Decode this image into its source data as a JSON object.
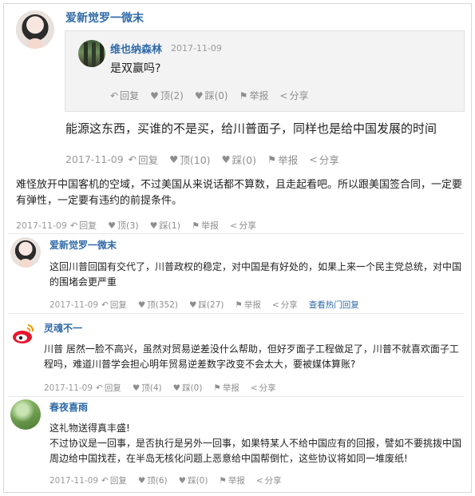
{
  "main_comment": {
    "user": "爱新觉罗一微末",
    "quote": {
      "user": "维也纳森林",
      "date": "2017-11-09",
      "text": "是双赢吗?",
      "reply": "回复",
      "like": "顶(2)",
      "dislike": "踩(0)",
      "report": "举报",
      "share": "分享"
    },
    "text": "能源这东西，买谁的不是买，给川普面子，同样也是给中国发展的时间",
    "date": "2017-11-09",
    "reply": "回复",
    "like": "顶(10)",
    "dislike": "踩(0)",
    "report": "举报",
    "share": "分享"
  },
  "plain_comment": {
    "text": "难怪放开中国客机的空域，不过美国从来说话都不算数，且走起看吧。所以跟美国签合同，一定要有弹性，一定要有违约的前提条件。",
    "date": "2017-11-09",
    "reply": "回复",
    "like": "顶(3)",
    "dislike": "踩(1)",
    "report": "举报",
    "share": "分享"
  },
  "comments": [
    {
      "user": "爱新觉罗一微末",
      "avatar": "avatar-girl-icon",
      "text": "这回川普回国有交代了，川普政权的稳定，对中国是有好处的，如果上来一个民主党总统，对中国的围堵会更严重",
      "date": "2017-11-09",
      "reply": "回复",
      "like": "顶(352)",
      "dislike": "踩(27)",
      "report": "举报",
      "share": "分享",
      "hot": "查看热门回复"
    },
    {
      "user": "灵魂不一",
      "avatar": "weibo-icon",
      "text": "川普 居然一脸不高兴，虽然对贸易逆差没什么帮助，但好歹面子工程做足了，川普不就喜欢面子工程吗，难道川普学会担心明年贸易逆差数字改变不会太大，要被媒体算账?",
      "date": "2017-11-09",
      "reply": "回复",
      "like": "顶(4)",
      "dislike": "踩(0)",
      "report": "举报",
      "share": "分享"
    },
    {
      "user": "春夜喜雨",
      "avatar": "avatar-grass-icon",
      "text_line1": "这礼物送得真丰盛!",
      "text_line2": "不过协议是一回事，是否执行是另外一回事，如果特某人不给中国应有的回报，譬如不要挑拨中国周边给中国找茬，在半岛无核化问题上恶意给中国帮倒忙，这些协议将如同一堆废纸!",
      "date": "2017-11-09",
      "reply": "回复",
      "like": "顶(6)",
      "dislike": "踩(0)",
      "report": "举报",
      "share": "分享"
    }
  ]
}
